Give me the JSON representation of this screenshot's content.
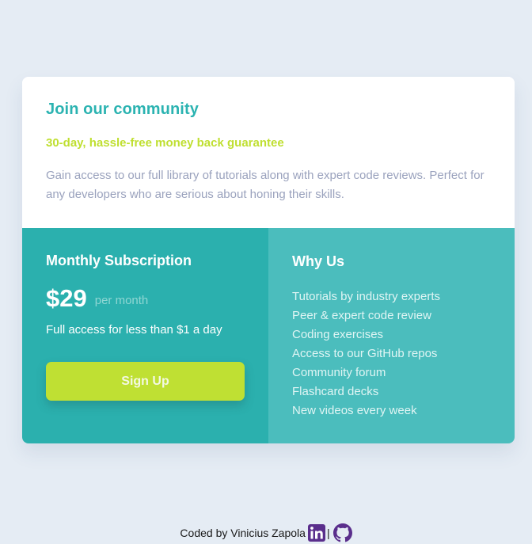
{
  "card": {
    "title": "Join our community",
    "guarantee": "30-day, hassle-free money back guarantee",
    "description": "Gain access to our full library of tutorials along with expert code reviews. Perfect for any developers who are serious about honing their skills."
  },
  "subscription": {
    "title": "Monthly Subscription",
    "price": "$29",
    "period": "per month",
    "access_text": "Full access for less than $1 a day",
    "signup_label": "Sign Up"
  },
  "why_us": {
    "title": "Why Us",
    "items": [
      "Tutorials by industry experts",
      "Peer & expert code review",
      "Coding exercises",
      "Access to our GitHub repos",
      "Community forum",
      "Flashcard decks",
      "New videos every week"
    ]
  },
  "footer": {
    "credit": "Coded by Vinicius Zapola",
    "separator": "|",
    "icons": [
      "linkedin-icon",
      "github-icon"
    ]
  },
  "colors": {
    "background": "#e5ecf4",
    "accent_teal": "#2bb3b1",
    "accent_lime": "#bfdf30",
    "text_muted": "#9aa2bd",
    "panel_left": "#2bb0ae",
    "panel_right": "#4bbdbd",
    "icon_purple": "#5a2e8c"
  }
}
